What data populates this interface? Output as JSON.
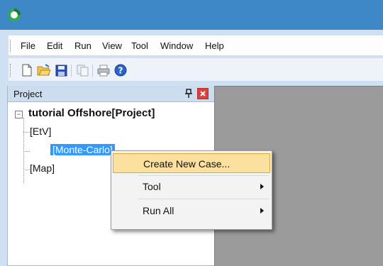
{
  "titlebar": {
    "icon": "app-ring-icon",
    "accent": "#3f88c8"
  },
  "menu": {
    "items": [
      "File",
      "Edit",
      "Run",
      "View",
      "Tool",
      "Window",
      "Help"
    ]
  },
  "toolbar": {
    "buttons": [
      "new-file-icon",
      "open-folder-icon",
      "save-icon",
      "copy-icon",
      "print-icon",
      "help-icon"
    ]
  },
  "project_panel": {
    "title": "Project",
    "tree": {
      "root": "tutorial Offshore[Project]",
      "children": [
        "[EtV]",
        "[Monte-Carlo]",
        "[Map]"
      ]
    }
  },
  "context_menu": {
    "items": [
      "Create New Case...",
      "Tool",
      "Run All"
    ],
    "highlighted": "Create New Case..."
  }
}
